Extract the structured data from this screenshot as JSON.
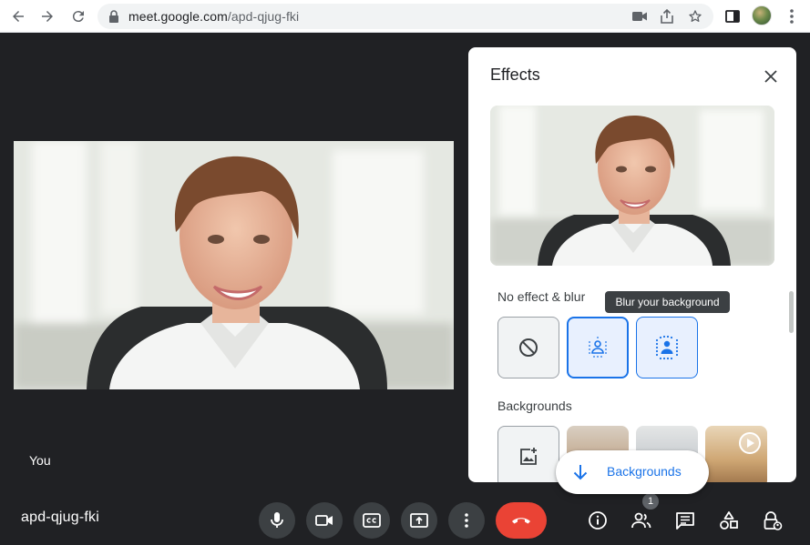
{
  "browser": {
    "url_host": "meet.google.com",
    "url_path": "/apd-qjug-fki"
  },
  "meeting": {
    "self_name": "You",
    "code": "apd-qjug-fki",
    "participant_count": "1",
    "end_call_color": "#ea4335"
  },
  "effects": {
    "title": "Effects",
    "section_blur": "No effect & blur",
    "tooltip": "Blur your background",
    "section_backgrounds": "Backgrounds",
    "backgrounds_button": "Backgrounds",
    "accent": "#1a73e8"
  },
  "icons": {
    "back": "arrow-left-icon",
    "forward": "arrow-right-icon",
    "reload": "reload-icon",
    "lock": "lock-icon",
    "camera_in_omnibox": "camera-icon",
    "share": "share-icon",
    "bookmark": "star-icon",
    "side_panel": "side-panel-icon",
    "menu": "kebab-menu-icon"
  }
}
